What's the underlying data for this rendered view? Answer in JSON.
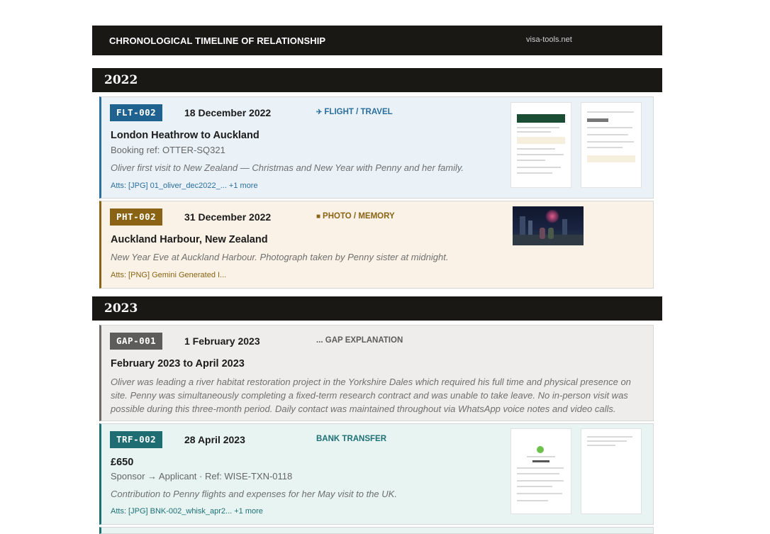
{
  "header": {
    "title": "CHRONOLOGICAL TIMELINE OF RELATIONSHIP",
    "site": "visa-tools.net"
  },
  "years": [
    "2022",
    "2023"
  ],
  "entries": [
    {
      "id": "FLT-002",
      "date": "18 December 2022",
      "category": "FLIGHT / TRAVEL",
      "icon": "plane-icon",
      "title": "London Heathrow to Auckland",
      "subtitle": "Booking ref: OTTER-SQ321",
      "description": "Oliver first visit to New Zealand — Christmas and New Year with Penny and her family.",
      "attachments": "Atts: [JPG] 01_oliver_dec2022_... +1 more"
    },
    {
      "id": "PHT-002",
      "date": "31 December 2022",
      "category": "PHOTO / MEMORY",
      "icon": "square-icon",
      "title": "Auckland Harbour, New Zealand",
      "description": "New Year Eve at Auckland Harbour. Photograph taken by Penny sister at midnight.",
      "attachments": "Atts: [PNG] Gemini Generated I..."
    },
    {
      "id": "GAP-001",
      "date": "1 February 2023",
      "category": "... GAP EXPLANATION",
      "title": "February 2023 to April 2023",
      "description": "Oliver was leading a river habitat restoration project in the Yorkshire Dales which required his full time and physical presence on site. Penny was simultaneously completing a fixed-term research contract and was unable to take leave. No in-person visit was possible during this three-month period. Daily contact was maintained throughout via WhatsApp voice notes and video calls."
    },
    {
      "id": "TRF-002",
      "date": "28 April 2023",
      "category": "BANK TRANSFER",
      "title": "£650",
      "subtitle": "Sponsor → Applicant · Ref: WISE-TXN-0118",
      "description": "Contribution to Penny flights and expenses for her May visit to the UK.",
      "attachments": "Atts: [JPG] BNK-002_whisk_apr2... +1 more"
    }
  ],
  "colors": {
    "flight": "#2a6f9e",
    "photo": "#8a6414",
    "gap": "#5e5c5a",
    "bank": "#1d7076",
    "bar": "#1a1815"
  }
}
